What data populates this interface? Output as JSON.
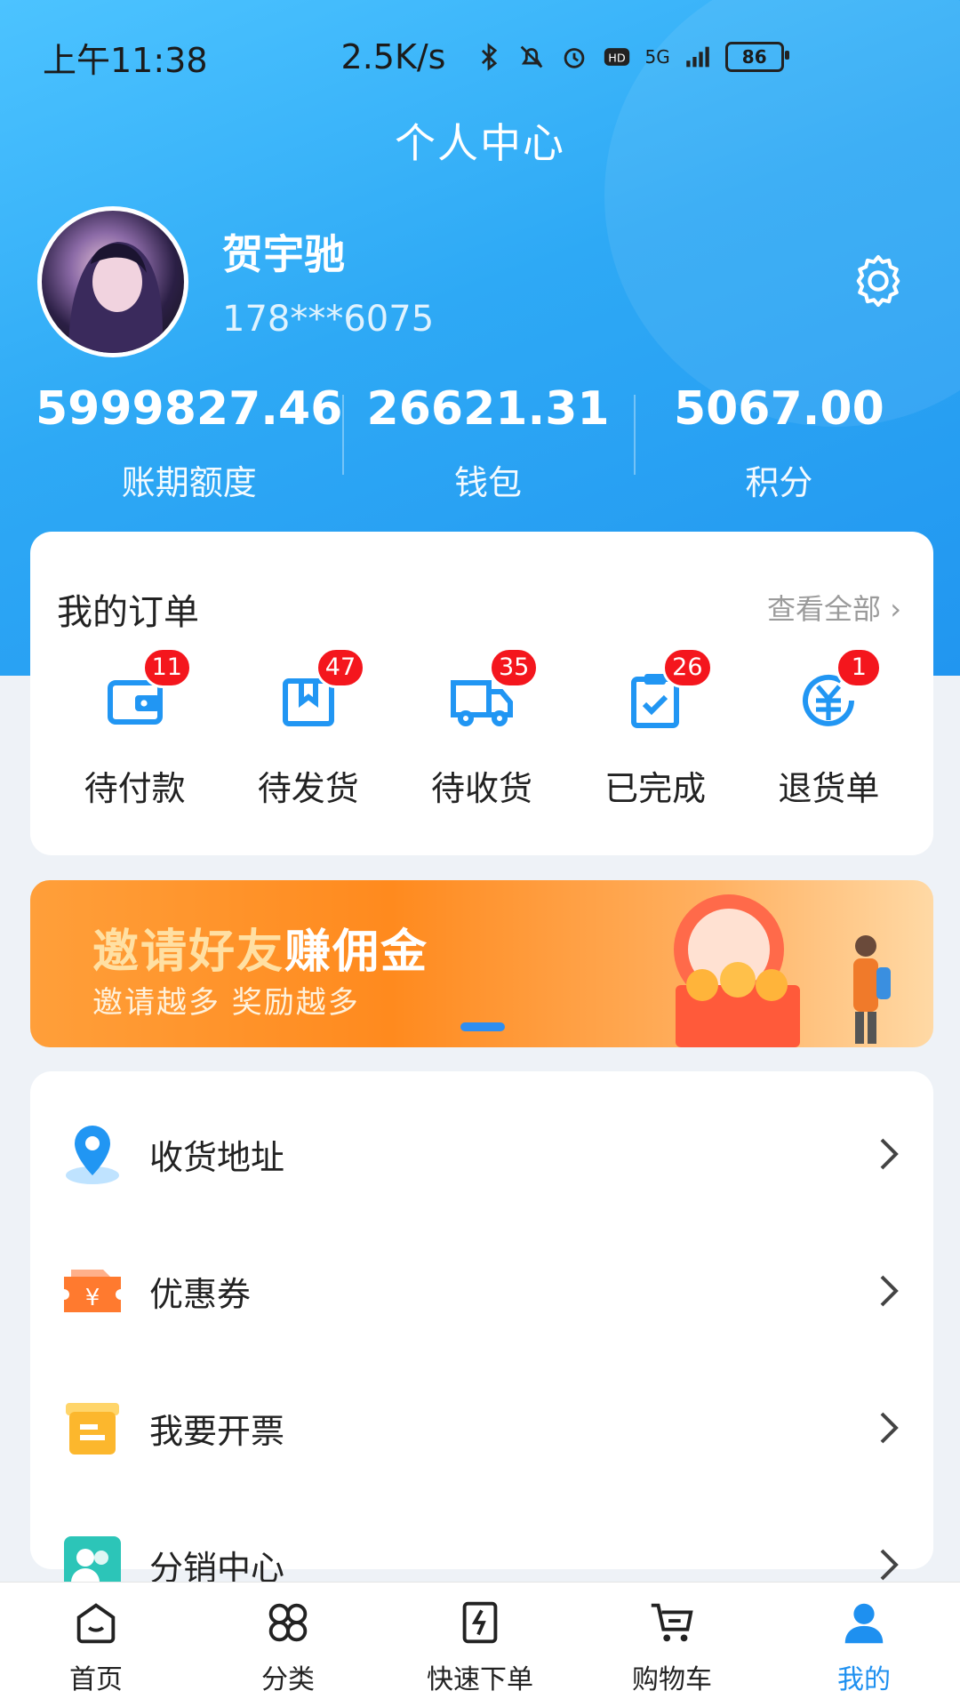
{
  "status_bar": {
    "time": "上午11:38",
    "speed": "2.5K/s",
    "network": "5G",
    "battery": "86"
  },
  "header": {
    "title": "个人中心"
  },
  "user": {
    "name": "贺宇驰",
    "phone": "178***6075"
  },
  "stats": [
    {
      "value": "5999827.46",
      "label": "账期额度"
    },
    {
      "value": "26621.31",
      "label": "钱包"
    },
    {
      "value": "5067.00",
      "label": "积分"
    }
  ],
  "orders": {
    "title": "我的订单",
    "view_all": "查看全部",
    "items": [
      {
        "label": "待付款",
        "count": "11",
        "icon": "wallet-icon"
      },
      {
        "label": "待发货",
        "count": "47",
        "icon": "package-icon"
      },
      {
        "label": "待收货",
        "count": "35",
        "icon": "truck-icon"
      },
      {
        "label": "已完成",
        "count": "26",
        "icon": "clipboard-check-icon"
      },
      {
        "label": "退货单",
        "count": "1",
        "icon": "yuan-refund-icon"
      }
    ]
  },
  "banner": {
    "title_a": "邀请好友",
    "title_b": "赚佣金",
    "subtitle": "邀请越多 奖励越多"
  },
  "menu": [
    {
      "label": "收货地址",
      "icon": "location-pin-icon",
      "color": "#2196f3"
    },
    {
      "label": "优惠券",
      "icon": "coupon-icon",
      "color": "#ff7a2f"
    },
    {
      "label": "我要开票",
      "icon": "invoice-icon",
      "color": "#fcb72d"
    },
    {
      "label": "分销中心",
      "icon": "users-icon",
      "color": "#2cc5b8"
    }
  ],
  "tabbar": [
    {
      "label": "首页",
      "icon": "home-icon",
      "active": false
    },
    {
      "label": "分类",
      "icon": "category-icon",
      "active": false
    },
    {
      "label": "快速下单",
      "icon": "quick-order-icon",
      "active": false
    },
    {
      "label": "购物车",
      "icon": "cart-icon",
      "active": false
    },
    {
      "label": "我的",
      "icon": "user-icon",
      "active": true
    }
  ],
  "colors": {
    "primary": "#2ea9f5",
    "badge": "#f4161d",
    "active_tab": "#1e90f0",
    "banner": "#ff8a1e"
  }
}
